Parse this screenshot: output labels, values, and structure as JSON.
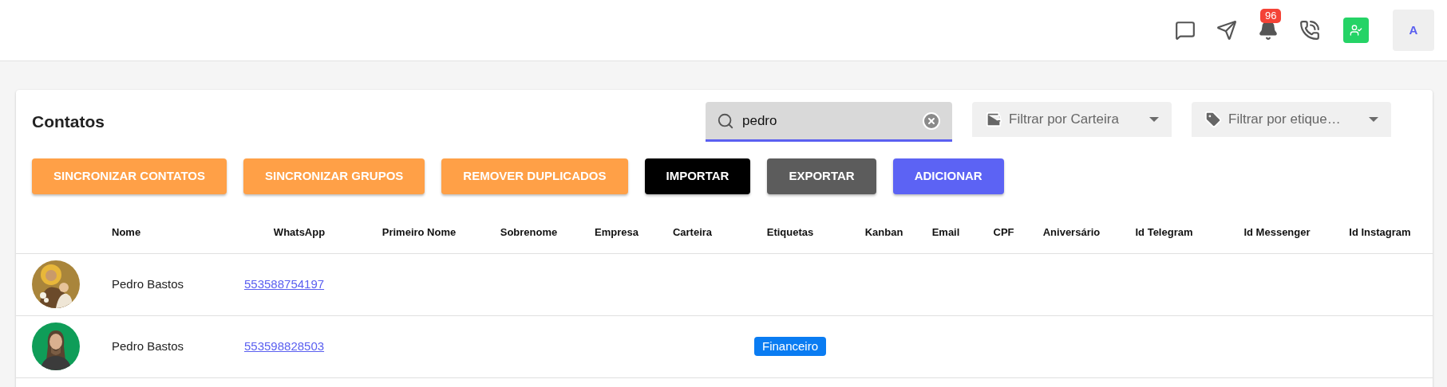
{
  "top_bar": {
    "notifications_count": "96",
    "profile_initial": "A"
  },
  "page": {
    "title": "Contatos"
  },
  "search": {
    "value": "pedro"
  },
  "filters": [
    {
      "kind": "wallet",
      "placeholder": "Filtrar por Carteira"
    },
    {
      "kind": "tag",
      "placeholder": "Filtrar por etique…"
    }
  ],
  "actions": [
    {
      "label": "SINCRONIZAR CONTATOS",
      "color": "#ffa047"
    },
    {
      "label": "SINCRONIZAR GRUPOS",
      "color": "#ffa047"
    },
    {
      "label": "REMOVER DUPLICADOS",
      "color": "#ffa047"
    },
    {
      "label": "IMPORTAR",
      "color": "#000000"
    },
    {
      "label": "EXPORTAR",
      "color": "#5c5c5c"
    },
    {
      "label": "ADICIONAR",
      "color": "#5c63f4"
    }
  ],
  "table": {
    "columns": [
      "Nome",
      "WhatsApp",
      "Primeiro Nome",
      "Sobrenome",
      "Empresa",
      "Carteira",
      "Etiquetas",
      "Kanban",
      "Email",
      "CPF",
      "Aniversário",
      "Id Telegram",
      "Id Messenger",
      "Id Instagram"
    ],
    "rows": [
      {
        "avatar": {
          "kind": "picture"
        },
        "name": "Pedro Bastos",
        "whatsapp": "553588754197",
        "tags": []
      },
      {
        "avatar": {
          "kind": "picture"
        },
        "name": "Pedro Bastos",
        "whatsapp": "553598828503",
        "tags": [
          {
            "label": "Financeiro",
            "color": "#0a7cf2"
          }
        ]
      }
    ]
  }
}
